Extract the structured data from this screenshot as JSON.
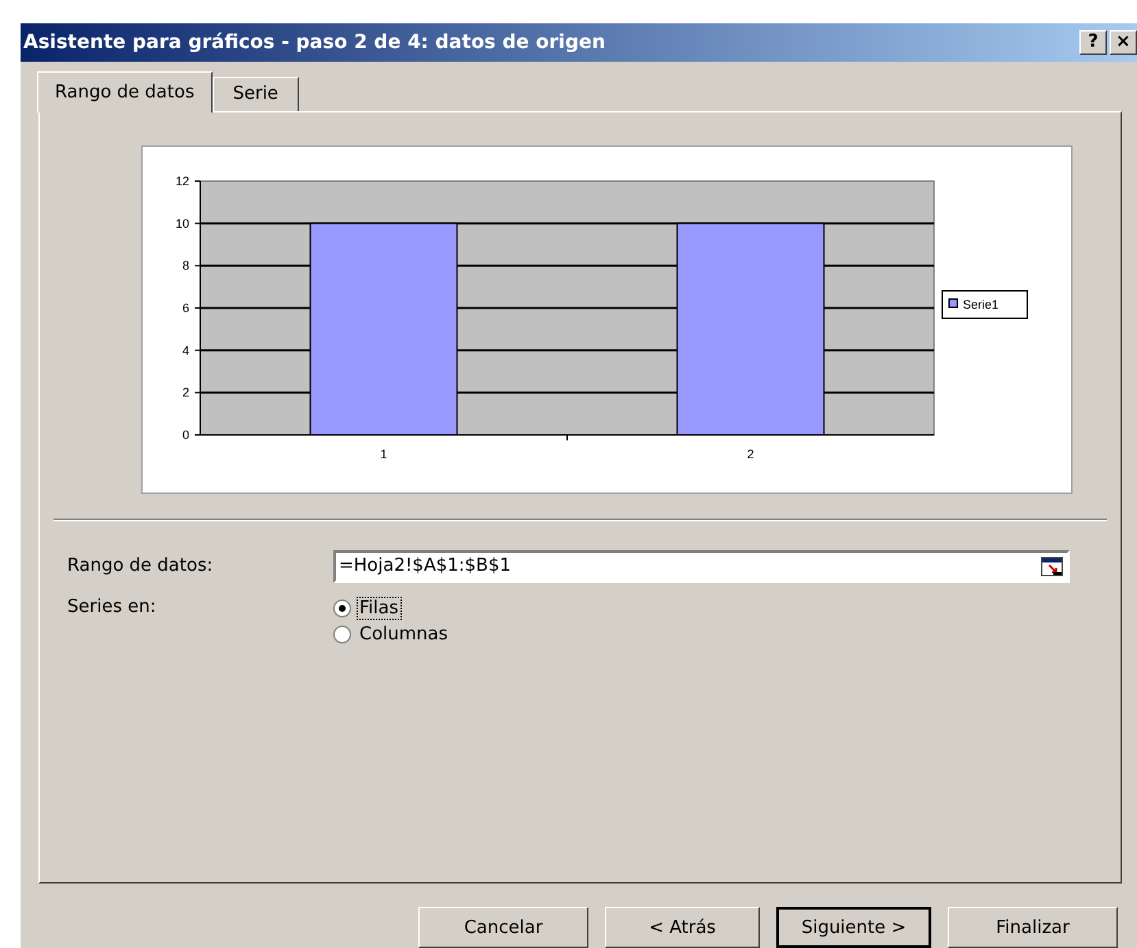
{
  "window": {
    "title": "Asistente para gráficos - paso 2 de 4: datos de origen",
    "help_button": "?",
    "close_button": "×"
  },
  "tabs": [
    {
      "label": "Rango de datos",
      "selected": true
    },
    {
      "label": "Serie",
      "selected": false
    }
  ],
  "preview": {
    "chart_data": {
      "type": "bar",
      "grid": true,
      "categories": [
        "1",
        "2"
      ],
      "series": [
        {
          "name": "Serie1",
          "color": "#9999ff",
          "values": [
            10,
            10
          ]
        }
      ],
      "ylim": [
        0,
        12
      ],
      "yticks": [
        0,
        2,
        4,
        6,
        8,
        10,
        12
      ]
    }
  },
  "range": {
    "label": "Rango de datos:",
    "value": "=Hoja2!$A$1:$B$1"
  },
  "series_in": {
    "label": "Series en:",
    "options": [
      {
        "label": "Filas",
        "selected": true
      },
      {
        "label": "Columnas",
        "selected": false
      }
    ]
  },
  "buttons": [
    {
      "label": "Cancelar",
      "default": false
    },
    {
      "label": "< Atrás",
      "default": false
    },
    {
      "label": "Siguiente >",
      "default": true
    },
    {
      "label": "Finalizar",
      "default": false
    }
  ]
}
